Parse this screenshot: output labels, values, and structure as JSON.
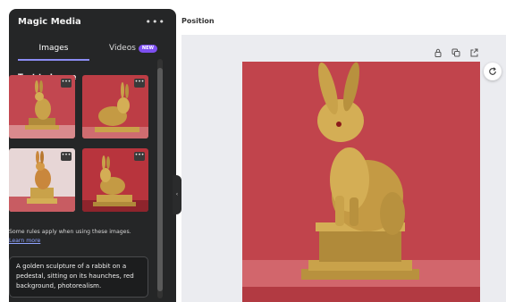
{
  "panel": {
    "title": "Magic Media",
    "more": "•••",
    "tabs": [
      {
        "label": "Images"
      },
      {
        "label": "Videos",
        "badge": "NEW"
      }
    ],
    "section_title": "Text to Image",
    "thumbnail_more": "•••",
    "rules_text": "Some rules apply when using these images.",
    "learn_more": "Learn more",
    "prompt": "A golden sculpture of a rabbit on a pedestal, sitting on its haunches, red background, photorealism.",
    "collapse_icon": "‹"
  },
  "header": {
    "breadcrumb": "Position"
  },
  "toolbar": {
    "icons": [
      "lock-icon",
      "copy-icon",
      "share-icon",
      "refresh-icon"
    ]
  },
  "colors": {
    "panel_bg": "#252627",
    "accent": "#8b8cf3",
    "badge": "#7d4ff0",
    "canvas_bg": "#ebecf0",
    "image_red": "#c1444c",
    "gold": "#c9a24a"
  }
}
